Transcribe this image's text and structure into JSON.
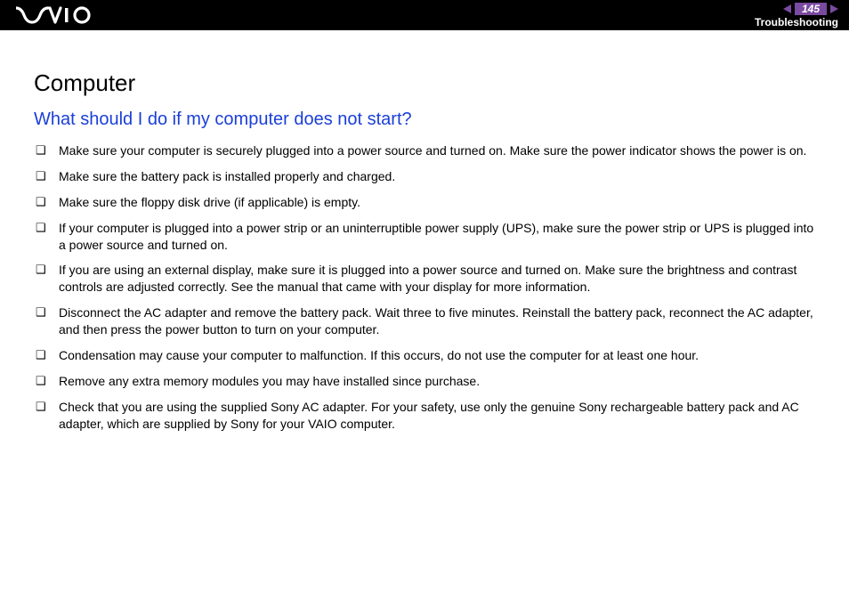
{
  "header": {
    "page_number": "145",
    "section": "Troubleshooting"
  },
  "content": {
    "title": "Computer",
    "subtitle": "What should I do if my computer does not start?",
    "bullets": [
      "Make sure your computer is securely plugged into a power source and turned on. Make sure the power indicator shows the power is on.",
      "Make sure the battery pack is installed properly and charged.",
      "Make sure the floppy disk drive (if applicable) is empty.",
      "If your computer is plugged into a power strip or an uninterruptible power supply (UPS), make sure the power strip or UPS is plugged into a power source and turned on.",
      "If you are using an external display, make sure it is plugged into a power source and turned on. Make sure the brightness and contrast controls are adjusted correctly. See the manual that came with your display for more information.",
      "Disconnect the AC adapter and remove the battery pack. Wait three to five minutes. Reinstall the battery pack, reconnect the AC adapter, and then press the power button to turn on your computer.",
      "Condensation may cause your computer to malfunction. If this occurs, do not use the computer for at least one hour.",
      "Remove any extra memory modules you may have installed since purchase.",
      "Check that you are using the supplied Sony AC adapter. For your safety, use only the genuine Sony rechargeable battery pack and AC adapter, which are supplied by Sony for your VAIO computer."
    ]
  }
}
